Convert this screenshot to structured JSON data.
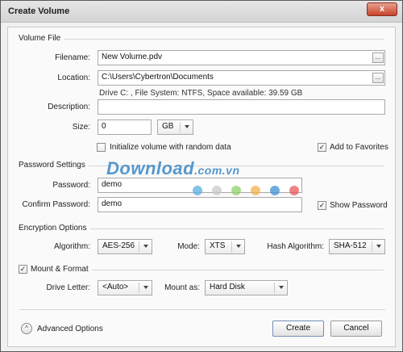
{
  "window": {
    "title": "Create Volume",
    "close_glyph": "x"
  },
  "volume_file": {
    "section_label": "Volume File",
    "filename_label": "Filename:",
    "filename_value": "New Volume.pdv",
    "location_label": "Location:",
    "location_value": "C:\\Users\\Cybertron\\Documents",
    "drive_info": "Drive C: , File System: NTFS, Space available: 39.59 GB",
    "description_label": "Description:",
    "description_value": "",
    "size_label": "Size:",
    "size_value": "0",
    "size_unit": "GB",
    "browse_glyph": "...",
    "init_random_label": "Initialize volume with random data",
    "init_random_checked": false,
    "add_favorites_label": "Add to Favorites",
    "add_favorites_checked": true
  },
  "password_settings": {
    "section_label": "Password Settings",
    "password_label": "Password:",
    "password_value": "demo",
    "confirm_label": "Confirm Password:",
    "confirm_value": "demo",
    "show_password_label": "Show Password",
    "show_password_checked": true
  },
  "encryption": {
    "section_label": "Encryption Options",
    "algorithm_label": "Algorithm:",
    "algorithm_value": "AES-256",
    "mode_label": "Mode:",
    "mode_value": "XTS",
    "hash_label": "Hash Algorithm:",
    "hash_value": "SHA-512"
  },
  "mount": {
    "section_label": "Mount & Format",
    "checked": true,
    "drive_letter_label": "Drive Letter:",
    "drive_letter_value": "<Auto>",
    "mount_as_label": "Mount as:",
    "mount_as_value": "Hard Disk"
  },
  "footer": {
    "advanced_label": "Advanced Options",
    "advanced_glyph": "^",
    "create_label": "Create",
    "cancel_label": "Cancel"
  },
  "watermark": {
    "text": "Download",
    "suffix": ".com.vn",
    "dot_colors": [
      "#5aaee0",
      "#c9c9c9",
      "#8fd06a",
      "#f2b14a",
      "#3f8fd6",
      "#e85a5a"
    ]
  },
  "check_glyph": "✓"
}
